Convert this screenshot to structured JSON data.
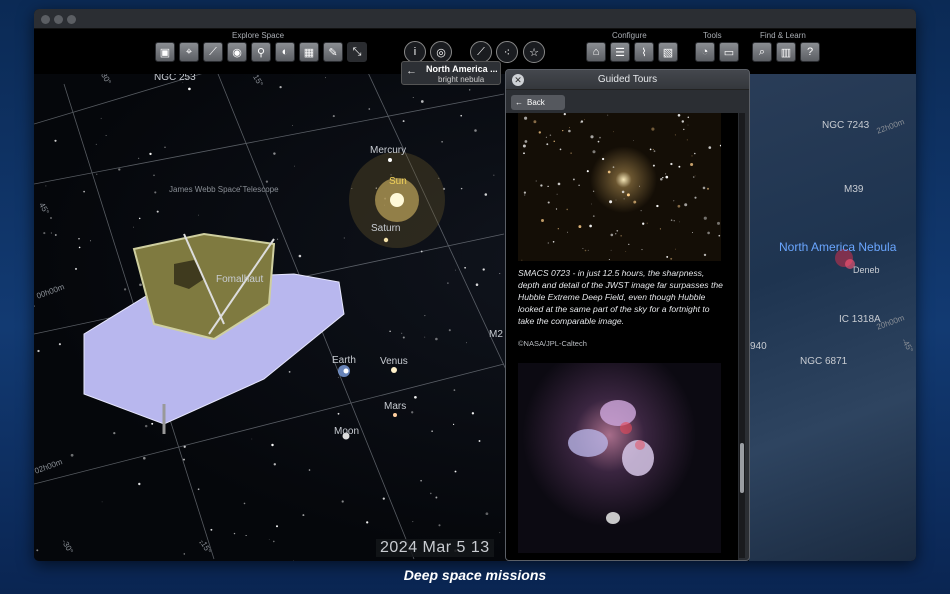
{
  "toolbar": {
    "groups": {
      "explore": "Explore Space",
      "configure": "Configure",
      "tools": "Tools",
      "find": "Find & Learn"
    },
    "explore_icons": [
      "save-icon",
      "location-icon",
      "telescope-icon",
      "eye-icon",
      "satellite-icon",
      "stopwatch-icon",
      "calendar-icon",
      "edit-icon",
      "cursor-icon"
    ],
    "center_icons": [
      "info-icon",
      "orbit-icon",
      "telescope-icon",
      "constellation-icon",
      "star-icon"
    ],
    "configure_icons": [
      "home-icon",
      "sliders-icon",
      "chart-icon",
      "grid-icon"
    ],
    "tools_icons": [
      "gauge-icon",
      "screen-icon"
    ],
    "find_icons": [
      "search-icon",
      "book-icon",
      "help-icon"
    ]
  },
  "selected_object": {
    "name": "North America ...",
    "type": "bright nebula"
  },
  "sky_labels": {
    "ngc253": "NGC 253",
    "jwst": "James Webb Space Telescope",
    "mercury": "Mercury",
    "sun": "Sun",
    "saturn": "Saturn",
    "fomalhaut": "Fomalhaut",
    "earth": "Earth",
    "venus": "Venus",
    "mars": "Mars",
    "moon": "Moon",
    "m2": "M2",
    "ngc7243": "NGC 7243",
    "m39": "M39",
    "north_america": "North America Nebula",
    "deneb": "Deneb",
    "ic1318a": "IC 1318A",
    "ngc6871": "NGC 6871",
    "n6940": "940",
    "grid_ra_00": "00h00m",
    "grid_ra_22": "22h00m",
    "grid_ra_20": "20h00m",
    "grid_ra_02": "02h00m",
    "grid_dec_30": "30°",
    "grid_dec_15": "15°",
    "grid_dec_45": "45°",
    "grid_dec_m15": "-15°",
    "grid_dec_m30": "-30°",
    "grid_dec_m45": "-45°"
  },
  "date_display": "2024 Mar  5  13",
  "tours": {
    "title": "Guided Tours",
    "back_label": "Back",
    "caption": "SMACS 0723 - in just 12.5 hours, the sharpness, depth and detail of the JWST image far surpasses the Hubble Extreme Deep Field, even though Hubble looked at the same part of the sky for a fortnight to take the comparable image.",
    "credit": "©NASA/JPL-Caltech"
  },
  "footer_caption": "Deep space missions",
  "colors": {
    "sun_label": "#f2d35a",
    "nebula_label": "#6aa6ff",
    "background": "#0b2a55"
  }
}
